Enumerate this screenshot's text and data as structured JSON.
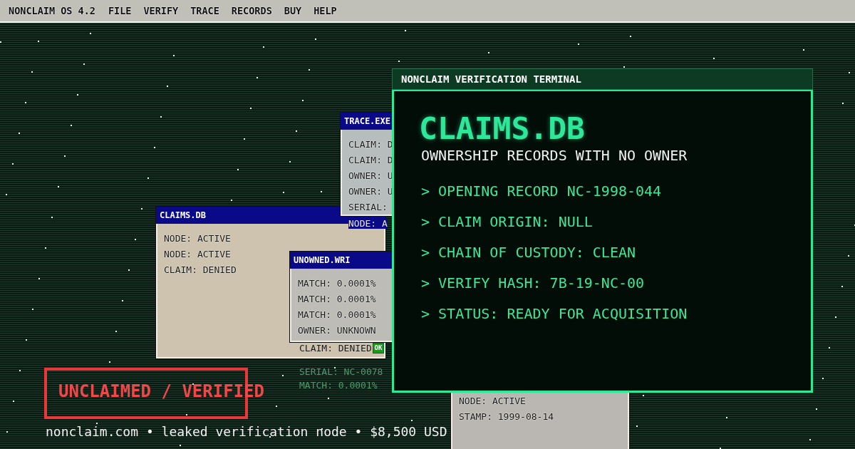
{
  "menu_bar": {
    "brand": "NONCLAIM OS 4.2",
    "items": [
      "FILE",
      "VERIFY",
      "TRACE",
      "RECORDS",
      "BUY",
      "HELP"
    ]
  },
  "windows": [
    {
      "kind": "dialog",
      "lines": [
        "NODE: ACTIVE",
        "STAMP: 1999-08-14"
      ]
    },
    {
      "kind": "dialog",
      "title": "CLAIMS.DB",
      "lines": [
        "NODE: ACTIVE",
        "NODE: ACTIVE",
        "CLAIM: DENIED"
      ],
      "footer_line": "CLAIM: DENIED",
      "button": "OK"
    },
    {
      "kind": "dialog",
      "title": "TRACE.EXE",
      "lines": [
        "CLAIM: D",
        "CLAIM: D",
        "OWNER: U",
        "OWNER: U",
        "SERIAL:"
      ],
      "overflow_line": "NODE: A"
    },
    {
      "kind": "dialog",
      "title": "UNOWNED.WRI",
      "lines": [
        "MATCH: 0.0001%",
        "MATCH: 0.0001%",
        "MATCH: 0.0001%",
        "OWNER: UNKNOWN"
      ]
    },
    {
      "kind": "terminal",
      "title": "NONCLAIM VERIFICATION TERMINAL",
      "heading": "CLAIMS.DB",
      "subheading": "OWNERSHIP RECORDS WITH NO OWNER",
      "lines": [
        "> OPENING RECORD NC-1998-044",
        "> CLAIM ORIGIN: NULL",
        "> CHAIN OF CUSTODY: CLEAN",
        "> VERIFY HASH: 7B-19-NC-00",
        "> STATUS: READY FOR ACQUISITION"
      ]
    }
  ],
  "faint_lines": [
    "SERIAL: NC-0078",
    "MATCH: 0.0001%"
  ],
  "stamp": "UNCLAIMED / VERIFIED",
  "footer": "nonclaim.com • leaked verification node • $8,500 USD"
}
